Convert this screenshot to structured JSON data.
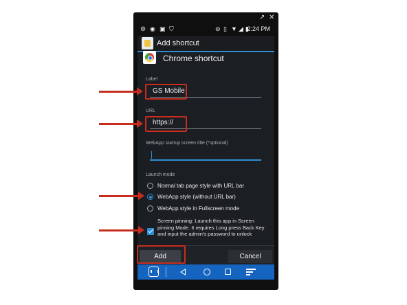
{
  "status_bar": {
    "time": "2:24 PM",
    "icons_left": [
      "gear-icon",
      "eye-icon",
      "teamviewer-icon",
      "shield-icon"
    ],
    "icons_right": [
      "do-not-disturb-icon",
      "vibrate-icon",
      "wifi-icon",
      "signal-icon",
      "battery-icon"
    ]
  },
  "dialog": {
    "title": "Add shortcut",
    "heading": "Chrome shortcut",
    "label_field": {
      "label": "Label",
      "value": "GS Mobile"
    },
    "url_field": {
      "label": "URL",
      "value": "https://"
    },
    "webapp_title_field": {
      "label": "WebApp startup screen title (*optional)",
      "value": ""
    },
    "launch_mode": {
      "label": "Launch mode",
      "options": [
        {
          "label": "Normal tab page style with URL bar",
          "checked": false
        },
        {
          "label": "WebApp style (without URL bar)",
          "checked": true
        },
        {
          "label": "WebApp style in Fullscreen mode",
          "checked": false
        }
      ]
    },
    "screen_pinning": {
      "checked": true,
      "text": "Screen pinning: Launch this app in Screen pinning Mode. It requires Long press Back Key and input the admin's password to unlock"
    },
    "add_label": "Add",
    "cancel_label": "Cancel"
  },
  "colors": {
    "accent": "#2f8fd6",
    "annotation": "#c62d1f",
    "navbar": "#1565c0"
  }
}
